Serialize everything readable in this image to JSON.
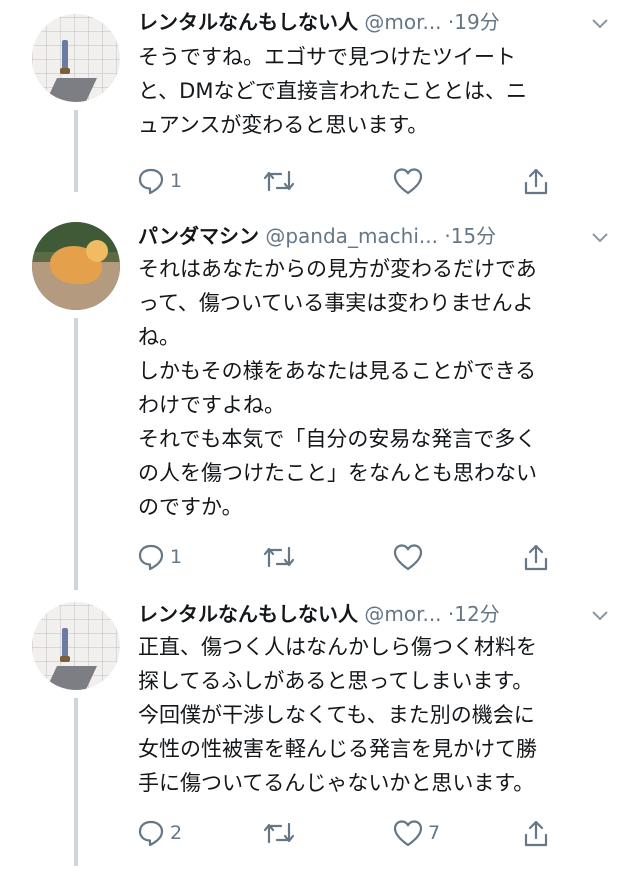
{
  "tweets": [
    {
      "name": "レンタルなんもしない人",
      "handle": "@mor...",
      "time": "19分",
      "text": "そうですね。エゴサで見つけたツイート\nと、DMなどで直接言われたこととは、ニ\nュアンスが変わると思います。",
      "reply_count": "1",
      "retweet_count": "",
      "like_count": "",
      "avatar": "tile-floor-figure"
    },
    {
      "name": "パンダマシン",
      "handle": "@panda_machi...",
      "time": "15分",
      "text": "それはあなたからの見方が変わるだけであ\nって、傷ついている事実は変わりませんよ\nね。\nしかもその様をあなたは見ることができる\nわけですよね。\nそれでも本気で「自分の安易な発言で多く\nの人を傷つけたこと」をなんとも思わない\nのですか。",
      "reply_count": "1",
      "retweet_count": "",
      "like_count": "",
      "avatar": "orange-cat"
    },
    {
      "name": "レンタルなんもしない人",
      "handle": "@mor...",
      "time": "12分",
      "text": "正直、傷つく人はなんかしら傷つく材料を\n探してるふしがあると思ってしまいます。\n今回僕が干渉しなくても、また別の機会に\n女性の性被害を軽んじる発言を見かけて勝\n手に傷ついてるんじゃないかと思います。",
      "reply_count": "2",
      "retweet_count": "",
      "like_count": "7",
      "avatar": "tile-floor-figure"
    }
  ],
  "icons": {
    "reply": "reply-icon",
    "retweet": "retweet-icon",
    "like": "heart-icon",
    "share": "share-icon",
    "more": "chevron-down-icon"
  },
  "colors": {
    "text": "#14171a",
    "muted": "#657786",
    "thread_line": "#ccd6dd"
  }
}
